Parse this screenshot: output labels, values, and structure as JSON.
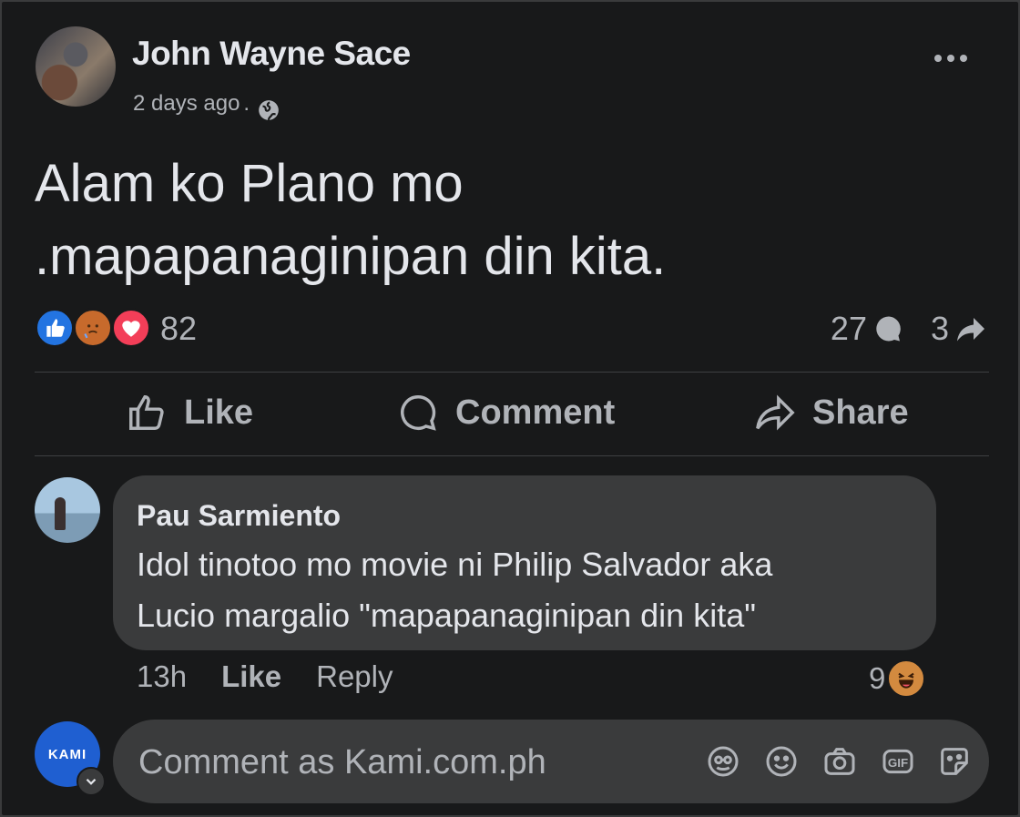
{
  "post": {
    "author": "John Wayne Sace",
    "time": "2 days ago",
    "separator": ".",
    "privacy_icon": "globe-icon",
    "text_line1": "Alam ko Plano mo",
    "text_line2": ".mapapanaginipan din kita.",
    "reaction_count": "82",
    "reaction_icons": [
      "like-reaction-icon",
      "care-reaction-icon",
      "love-reaction-icon"
    ],
    "comment_count": "27",
    "share_count": "3"
  },
  "actions": {
    "like": "Like",
    "comment": "Comment",
    "share": "Share"
  },
  "comment": {
    "author": "Pau Sarmiento",
    "line1": "Idol tinotoo mo movie ni Philip Salvador aka",
    "line2": "Lucio margalio \"mapapanaginipan din kita\"",
    "time": "13h",
    "like": "Like",
    "reply": "Reply",
    "reaction_count": "9",
    "reaction_icon": "haha-reaction-icon"
  },
  "composer": {
    "avatar_text": "KAMI",
    "placeholder": "Comment as Kami.com.ph",
    "tools": [
      "avatar-sticker-icon",
      "emoji-icon",
      "camera-icon",
      "gif-icon",
      "sticker-icon"
    ]
  },
  "colors": {
    "background": "#18191a",
    "bubble": "#3a3b3c",
    "primary_text": "#e4e6eb",
    "secondary_text": "#b0b3b8",
    "like_blue": "#2374e1",
    "love_red": "#f33e58"
  }
}
